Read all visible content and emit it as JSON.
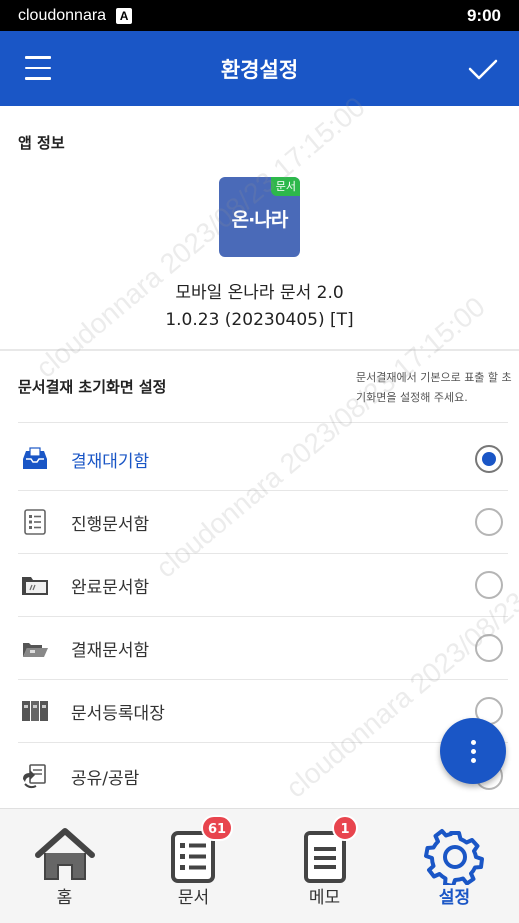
{
  "status_bar": {
    "carrier": "cloudonnara",
    "notif_glyph": "A",
    "time": "9:00"
  },
  "app_bar": {
    "title": "환경설정",
    "menu_icon": "hamburger-menu-icon",
    "confirm_icon": "checkmark-icon"
  },
  "app_info": {
    "section_title": "앱 정보",
    "icon_tag": "문서",
    "icon_logo": "온·나라",
    "app_name": "모바일 온나라 문서 2.0",
    "version": "1.0.23 (20230405) [T]"
  },
  "initial_screen": {
    "section_title": "문서결재 초기화면 설정",
    "hint": "문서결재에서 기본으로 표출 할 초기화면을 설정해 주세요.",
    "options": [
      {
        "label": "결재대기함",
        "icon": "inbox-tray-icon",
        "selected": true
      },
      {
        "label": "진행문서함",
        "icon": "list-document-icon",
        "selected": false
      },
      {
        "label": "완료문서함",
        "icon": "folder-icon",
        "selected": false
      },
      {
        "label": "결재문서함",
        "icon": "open-folder-icon",
        "selected": false
      },
      {
        "label": "문서등록대장",
        "icon": "binders-icon",
        "selected": false
      },
      {
        "label": "공유/공람",
        "icon": "share-document-icon",
        "selected": false
      }
    ]
  },
  "fab": {
    "icon": "more-vertical-icon"
  },
  "bottom_nav": [
    {
      "label": "홈",
      "icon": "home-icon",
      "badge": "",
      "active": false
    },
    {
      "label": "문서",
      "icon": "document-list-icon",
      "badge": "61",
      "active": false
    },
    {
      "label": "메모",
      "icon": "memo-icon",
      "badge": "1",
      "active": false
    },
    {
      "label": "설정",
      "icon": "gear-icon",
      "badge": "",
      "active": true
    }
  ],
  "watermark": "cloudonnara 2023/08/23 17:15:00",
  "colors": {
    "primary": "#1a56c6",
    "badge": "#e8454e",
    "icon_tag": "#2db84b",
    "icon_bg": "#4a6ab8"
  }
}
